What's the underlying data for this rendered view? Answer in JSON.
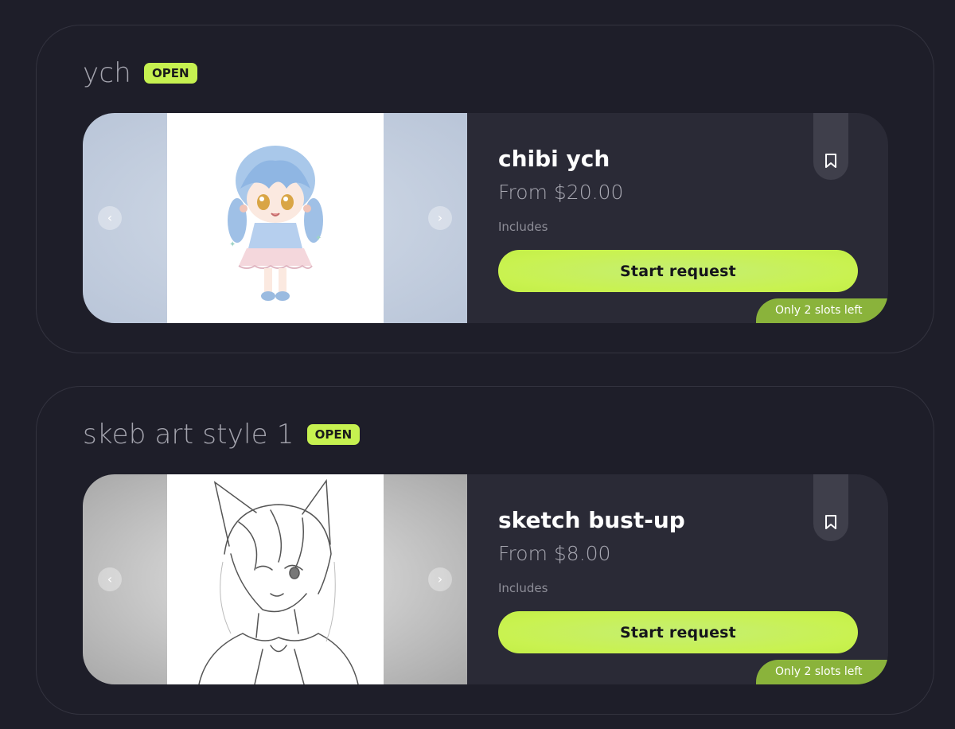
{
  "sections": [
    {
      "title": "ych",
      "status": "OPEN",
      "card": {
        "title": "chibi ych",
        "price": "From $20.00",
        "includes": "Includes",
        "cta": "Start request",
        "slots": "Only 2 slots left",
        "prev_icon": "‹",
        "next_icon": "›"
      }
    },
    {
      "title": "skeb art style 1",
      "status": "OPEN",
      "card": {
        "title": "sketch bust-up",
        "price": "From $8.00",
        "includes": "Includes",
        "cta": "Start request",
        "slots": "Only 2 slots left",
        "prev_icon": "‹",
        "next_icon": "›"
      }
    }
  ],
  "colors": {
    "background": "#1e1e29",
    "card": "#2a2a36",
    "accent": "#c6f150",
    "slots_tag": "#8ab33b"
  },
  "icons": {
    "bookmark": "bookmark-icon",
    "prev": "chevron-left-icon",
    "next": "chevron-right-icon"
  }
}
